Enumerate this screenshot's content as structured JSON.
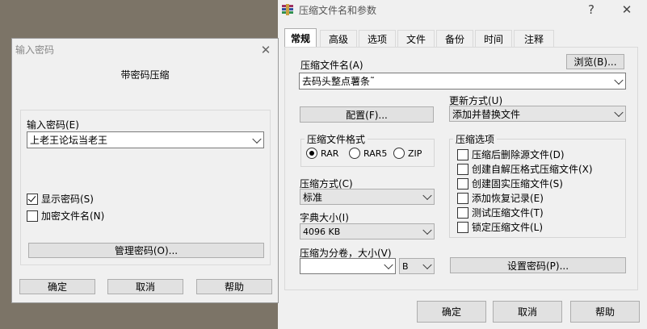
{
  "pwd_dialog": {
    "title": "输入密码",
    "header": "带密码压缩",
    "password_label": "输入密码(E)",
    "password_value": "上老王论坛当老王",
    "show_password": "显示密码(S)",
    "encrypt_names": "加密文件名(N)",
    "manage_button": "管理密码(O)...",
    "ok": "确定",
    "cancel": "取消",
    "help": "帮助",
    "show_checked": true,
    "encrypt_checked": false
  },
  "main_dialog": {
    "title": "压缩文件名和参数",
    "help_btn": "?",
    "close_btn": "✕",
    "tabs": [
      "常规",
      "高级",
      "选项",
      "文件",
      "备份",
      "时间",
      "注释"
    ],
    "archive_name_label": "压缩文件名(A)",
    "browse": "浏览(B)...",
    "archive_name_value": "去码头整点薯条˜",
    "update_label": "更新方式(U)",
    "update_value": "添加并替换文件",
    "profile_button": "配置(F)...",
    "format_group": "压缩文件格式",
    "formats": [
      "RAR",
      "RAR5",
      "ZIP"
    ],
    "options_group": "压缩选项",
    "options": [
      "压缩后删除源文件(D)",
      "创建自解压格式压缩文件(X)",
      "创建固实压缩文件(S)",
      "添加恢复记录(E)",
      "测试压缩文件(T)",
      "锁定压缩文件(L)"
    ],
    "method_label": "压缩方式(C)",
    "method_value": "标准",
    "dict_label": "字典大小(I)",
    "dict_value": "4096 KB",
    "split_label": "压缩为分卷，大小(V)",
    "split_value": "",
    "split_unit": "B",
    "set_password": "设置密码(P)...",
    "ok": "确定",
    "cancel": "取消",
    "help": "帮助"
  }
}
